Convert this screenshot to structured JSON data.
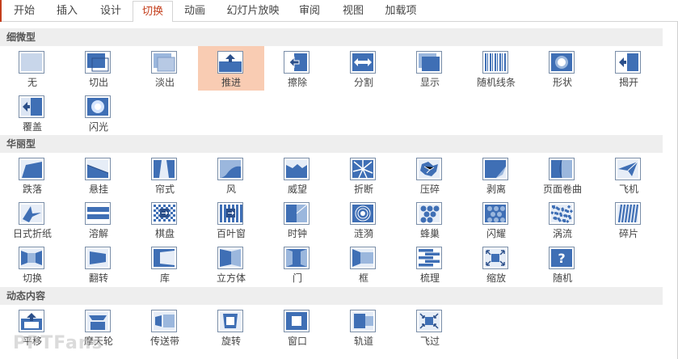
{
  "tabs": [
    {
      "label": "开始"
    },
    {
      "label": "插入"
    },
    {
      "label": "设计"
    },
    {
      "label": "切换",
      "active": true
    },
    {
      "label": "动画"
    },
    {
      "label": "幻灯片放映"
    },
    {
      "label": "审阅"
    },
    {
      "label": "视图"
    },
    {
      "label": "加载项"
    }
  ],
  "groups": [
    {
      "title": "细微型",
      "items": [
        {
          "label": "无",
          "icon": "none-icon"
        },
        {
          "label": "切出",
          "icon": "cut-icon"
        },
        {
          "label": "淡出",
          "icon": "fade-icon"
        },
        {
          "label": "推进",
          "icon": "push-icon",
          "selected": true
        },
        {
          "label": "擦除",
          "icon": "wipe-icon"
        },
        {
          "label": "分割",
          "icon": "split-icon"
        },
        {
          "label": "显示",
          "icon": "reveal-icon"
        },
        {
          "label": "随机线条",
          "icon": "random-bars-icon"
        },
        {
          "label": "形状",
          "icon": "shape-icon"
        },
        {
          "label": "揭开",
          "icon": "uncover-icon"
        },
        {
          "label": "覆盖",
          "icon": "cover-icon"
        },
        {
          "label": "闪光",
          "icon": "flash-icon"
        }
      ]
    },
    {
      "title": "华丽型",
      "items": [
        {
          "label": "跌落",
          "icon": "fall-over-icon"
        },
        {
          "label": "悬挂",
          "icon": "drape-icon"
        },
        {
          "label": "帘式",
          "icon": "curtains-icon"
        },
        {
          "label": "风",
          "icon": "wind-icon"
        },
        {
          "label": "威望",
          "icon": "prestige-icon"
        },
        {
          "label": "折断",
          "icon": "fracture-icon"
        },
        {
          "label": "压碎",
          "icon": "crush-icon"
        },
        {
          "label": "剥离",
          "icon": "peel-off-icon"
        },
        {
          "label": "页面卷曲",
          "icon": "page-curl-icon"
        },
        {
          "label": "飞机",
          "icon": "airplane-icon"
        },
        {
          "label": "日式折纸",
          "icon": "origami-icon"
        },
        {
          "label": "溶解",
          "icon": "dissolve-icon"
        },
        {
          "label": "棋盘",
          "icon": "checkerboard-icon"
        },
        {
          "label": "百叶窗",
          "icon": "blinds-icon"
        },
        {
          "label": "时钟",
          "icon": "clock-icon"
        },
        {
          "label": "涟漪",
          "icon": "ripple-icon"
        },
        {
          "label": "蜂巢",
          "icon": "honeycomb-icon"
        },
        {
          "label": "闪耀",
          "icon": "glitter-icon"
        },
        {
          "label": "涡流",
          "icon": "vortex-icon"
        },
        {
          "label": "碎片",
          "icon": "shred-icon"
        },
        {
          "label": "切换",
          "icon": "switch-icon"
        },
        {
          "label": "翻转",
          "icon": "flip-icon"
        },
        {
          "label": "库",
          "icon": "gallery-icon"
        },
        {
          "label": "立方体",
          "icon": "cube-icon"
        },
        {
          "label": "门",
          "icon": "doors-icon"
        },
        {
          "label": "框",
          "icon": "box-icon"
        },
        {
          "label": "梳理",
          "icon": "comb-icon"
        },
        {
          "label": "缩放",
          "icon": "zoom-icon"
        },
        {
          "label": "随机",
          "icon": "random-icon"
        }
      ]
    },
    {
      "title": "动态内容",
      "items": [
        {
          "label": "平移",
          "icon": "pan-icon"
        },
        {
          "label": "摩天轮",
          "icon": "ferris-wheel-icon"
        },
        {
          "label": "传送带",
          "icon": "conveyor-icon"
        },
        {
          "label": "旋转",
          "icon": "rotate-icon"
        },
        {
          "label": "窗口",
          "icon": "window-icon"
        },
        {
          "label": "轨道",
          "icon": "orbit-icon"
        },
        {
          "label": "飞过",
          "icon": "fly-through-icon"
        }
      ]
    }
  ],
  "watermark": "PPTFans"
}
